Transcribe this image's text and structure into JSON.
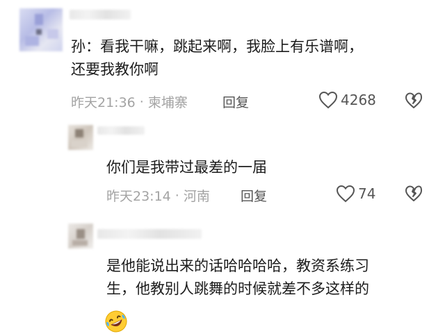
{
  "comments": [
    {
      "text_lines": [
        "孙：看我干嘛，跳起来啊，我脸上有乐谱啊，",
        "还要我教你啊"
      ],
      "time": "昨天21:36",
      "location": "柬埔寨",
      "reply_label": "回复",
      "likes": "4268"
    },
    {
      "text_lines": [
        "你们是我带过最差的一届"
      ],
      "time": "昨天23:14",
      "location": "河南",
      "reply_label": "回复",
      "likes": "74"
    },
    {
      "text_lines": [
        "是他能说出来的话哈哈哈哈，教资系练习",
        "生，他教别人跳舞的时候就差不多这样的"
      ],
      "emoji": "rolling-on-floor-laughing-emoji"
    }
  ],
  "separator": "·",
  "colors": {
    "text": "#1c1c1c",
    "meta": "#a3a3a3",
    "action": "#555555"
  }
}
